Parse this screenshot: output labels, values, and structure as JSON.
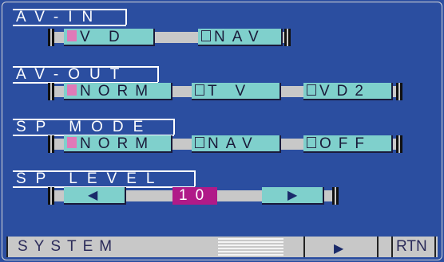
{
  "sections": {
    "av_in": {
      "title": "AV-IN",
      "options": [
        "V  D",
        "NAV"
      ]
    },
    "av_out": {
      "title": "AV-OUT",
      "options": [
        "NORM",
        "T  V",
        "VD2"
      ]
    },
    "sp_mode": {
      "title": "SP MODE",
      "options": [
        "NORM",
        "NAV",
        "OFF"
      ]
    },
    "sp_level": {
      "title": "SP LEVEL",
      "value": "10",
      "left_arrow": "◀",
      "right_arrow": "▶"
    }
  },
  "bottom_bar": {
    "label": "SYSTEM",
    "next_arrow": "▶",
    "return_label": "RTN"
  },
  "colors": {
    "background": "#2b4ea0",
    "button": "#7fd0cc",
    "checked": "#e07ab8",
    "value": "#b01a88",
    "bar": "#c8c8c8"
  }
}
